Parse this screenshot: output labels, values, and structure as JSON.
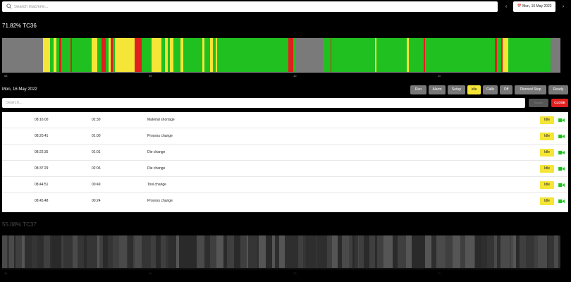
{
  "search": {
    "placeholder": "Search machine..."
  },
  "date_picker": {
    "prev_icon": "chevron-left-icon",
    "next_icon": "chevron-right-icon",
    "calendar_icon": "calendar-icon",
    "value": "Mon, 16 May 2022"
  },
  "machine1": {
    "title": "71.82% TC36",
    "ticks": [
      "08",
      "09",
      "10",
      "11"
    ],
    "colors": {
      "run": "#1fc01f",
      "idle": "#f5e536",
      "alarm": "#e01f1f",
      "off": "#7a7a7a"
    },
    "segments": [
      {
        "state": "off",
        "from": 0,
        "to": 7.3
      },
      {
        "state": "idle",
        "from": 7.3,
        "to": 8.6
      },
      {
        "state": "run",
        "from": 8.6,
        "to": 9.2
      },
      {
        "state": "idle",
        "from": 9.2,
        "to": 9.7
      },
      {
        "state": "run",
        "from": 9.7,
        "to": 10.2
      },
      {
        "state": "alarm",
        "from": 10.2,
        "to": 10.6
      },
      {
        "state": "run",
        "from": 10.6,
        "to": 12.2
      },
      {
        "state": "alarm",
        "from": 12.2,
        "to": 12.5
      },
      {
        "state": "run",
        "from": 12.5,
        "to": 16.0
      },
      {
        "state": "idle",
        "from": 16.0,
        "to": 17.0
      },
      {
        "state": "run",
        "from": 17.0,
        "to": 17.8
      },
      {
        "state": "alarm",
        "from": 17.8,
        "to": 18.6
      },
      {
        "state": "run",
        "from": 18.6,
        "to": 19.1
      },
      {
        "state": "idle",
        "from": 19.1,
        "to": 19.5
      },
      {
        "state": "alarm",
        "from": 19.5,
        "to": 19.8
      },
      {
        "state": "run",
        "from": 19.8,
        "to": 20.2
      },
      {
        "state": "idle",
        "from": 20.2,
        "to": 23.8
      },
      {
        "state": "alarm",
        "from": 23.8,
        "to": 25.0
      },
      {
        "state": "run",
        "from": 25.0,
        "to": 26.8
      },
      {
        "state": "idle",
        "from": 26.8,
        "to": 28.5
      },
      {
        "state": "run",
        "from": 28.5,
        "to": 29.2
      },
      {
        "state": "idle",
        "from": 29.2,
        "to": 29.7
      },
      {
        "state": "run",
        "from": 29.7,
        "to": 30.1
      },
      {
        "state": "idle",
        "from": 30.1,
        "to": 30.7
      },
      {
        "state": "run",
        "from": 30.7,
        "to": 32.0
      },
      {
        "state": "idle",
        "from": 32.0,
        "to": 32.4
      },
      {
        "state": "run",
        "from": 32.4,
        "to": 35.8
      },
      {
        "state": "idle",
        "from": 35.8,
        "to": 36.2
      },
      {
        "state": "run",
        "from": 36.2,
        "to": 37.2
      },
      {
        "state": "idle",
        "from": 37.2,
        "to": 37.7
      },
      {
        "state": "run",
        "from": 37.7,
        "to": 38.2
      },
      {
        "state": "idle",
        "from": 38.2,
        "to": 38.5
      },
      {
        "state": "run",
        "from": 38.5,
        "to": 51.3
      },
      {
        "state": "alarm",
        "from": 51.3,
        "to": 52.2
      },
      {
        "state": "run",
        "from": 52.2,
        "to": 52.7
      },
      {
        "state": "off",
        "from": 52.7,
        "to": 57.5
      },
      {
        "state": "run",
        "from": 57.5,
        "to": 58.8
      },
      {
        "state": "alarm",
        "from": 58.8,
        "to": 59.0
      },
      {
        "state": "run",
        "from": 59.0,
        "to": 66.8
      },
      {
        "state": "idle",
        "from": 66.8,
        "to": 67.0
      },
      {
        "state": "run",
        "from": 67.0,
        "to": 72.5
      },
      {
        "state": "idle",
        "from": 72.5,
        "to": 72.8
      },
      {
        "state": "run",
        "from": 72.8,
        "to": 75.5
      },
      {
        "state": "alarm",
        "from": 75.5,
        "to": 75.8
      },
      {
        "state": "run",
        "from": 75.8,
        "to": 88.3
      },
      {
        "state": "alarm",
        "from": 88.3,
        "to": 88.7
      },
      {
        "state": "run",
        "from": 88.7,
        "to": 89.4
      },
      {
        "state": "alarm",
        "from": 89.4,
        "to": 89.7
      },
      {
        "state": "idle",
        "from": 89.7,
        "to": 90.6
      },
      {
        "state": "run",
        "from": 90.6,
        "to": 98.2
      },
      {
        "state": "off",
        "from": 98.2,
        "to": 100
      }
    ]
  },
  "details": {
    "date": "Mon, 16 May 2022",
    "filters": [
      {
        "label": "Run",
        "active": false
      },
      {
        "label": "Alarm",
        "active": false
      },
      {
        "label": "Setup",
        "active": false
      },
      {
        "label": "Idle",
        "active": true
      },
      {
        "label": "Calls",
        "active": false
      },
      {
        "label": "Off",
        "active": false
      },
      {
        "label": "Planned Stop",
        "active": false
      },
      {
        "label": "Ready",
        "active": false
      }
    ],
    "search_placeholder": "Search...",
    "gray_button": "Search",
    "close_label": "CLOSE",
    "rows": [
      {
        "time": "08:16:00",
        "duration": "02:39",
        "reason": "Material shortage",
        "state": "Idle"
      },
      {
        "time": "08:20:41",
        "duration": "01:00",
        "reason": "Process change",
        "state": "Idle"
      },
      {
        "time": "08:22:35",
        "duration": "01:01",
        "reason": "Die change",
        "state": "Idle"
      },
      {
        "time": "08:37:29",
        "duration": "02:06",
        "reason": "Die change",
        "state": "Idle"
      },
      {
        "time": "08:44:51",
        "duration": "00:49",
        "reason": "Tool change",
        "state": "Idle"
      },
      {
        "time": "08:45:48",
        "duration": "00:24",
        "reason": "Process change",
        "state": "Idle"
      }
    ]
  },
  "machine2": {
    "title": "55.08% TC37",
    "ticks": [
      "08",
      "09",
      "10",
      "11"
    ]
  }
}
